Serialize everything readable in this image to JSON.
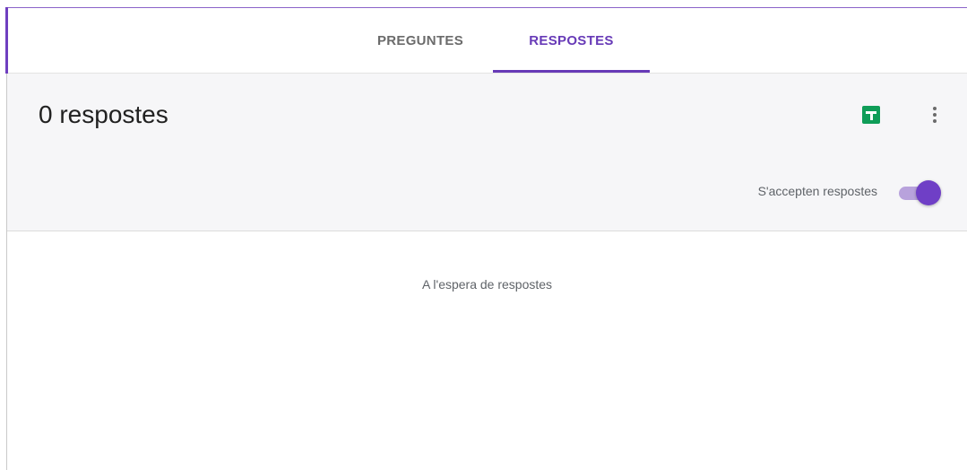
{
  "tabs": {
    "questions_label": "PREGUNTES",
    "responses_label": "RESPOSTES",
    "active": "RESPOSTES"
  },
  "summary": {
    "count_title": "0 respostes",
    "sheets_icon": "sheets-icon",
    "more_icon": "more-vertical-icon",
    "accepting_label": "S'accepten respostes",
    "accepting": true
  },
  "body": {
    "empty_message": "A l'espera de respostes"
  },
  "colors": {
    "accent": "#673ab7",
    "sheets_green": "#0f9d58",
    "summary_bg": "#f6f6f8"
  }
}
